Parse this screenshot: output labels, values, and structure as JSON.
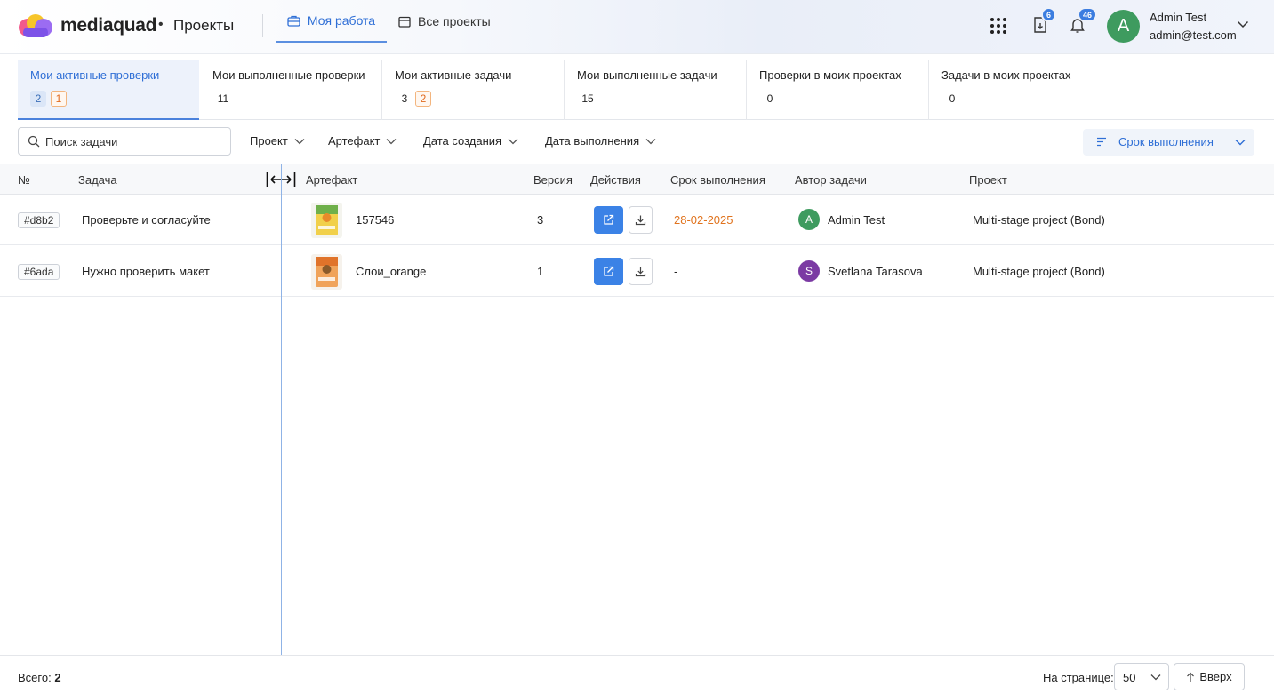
{
  "header": {
    "brand": "mediaquad",
    "separator_dot": "•",
    "app_title": "Проекты",
    "nav": [
      {
        "label": "Моя работа",
        "active": true,
        "icon": "briefcase-icon"
      },
      {
        "label": "Все проекты",
        "active": false,
        "icon": "calendar-icon"
      }
    ],
    "downloads_badge": "6",
    "notifications_badge": "46",
    "user": {
      "initial": "A",
      "name": "Admin Test",
      "email": "admin@test.com",
      "avatar_color": "#3e9b5f"
    }
  },
  "summary_tabs": [
    {
      "label": "Мои активные проверки",
      "counts": [
        "2",
        "1"
      ],
      "active": true
    },
    {
      "label": "Мои выполненные проверки",
      "counts": [
        "11"
      ]
    },
    {
      "label": "Мои активные задачи",
      "counts": [
        "3",
        "2"
      ]
    },
    {
      "label": "Мои выполненные задачи",
      "counts": [
        "15"
      ]
    },
    {
      "label": "Проверки в моих проектах",
      "counts": [
        "0"
      ]
    },
    {
      "label": "Задачи в моих проектах",
      "counts": [
        "0"
      ]
    }
  ],
  "filters": {
    "search_placeholder": "Поиск задачи",
    "project": "Проект",
    "artifact": "Артефакт",
    "created": "Дата создания",
    "due": "Дата выполнения",
    "sort_label": "Срок выполнения"
  },
  "table": {
    "columns": [
      "№",
      "Задача",
      "Артефакт",
      "Версия",
      "Действия",
      "Срок выполнения",
      "Автор задачи",
      "Проект"
    ],
    "rows": [
      {
        "id": "#d8b2",
        "task": "Проверьте и согласуйте",
        "artifact": "157546",
        "version": "3",
        "due": "28-02-2025",
        "due_color": "#e0731e",
        "author_initial": "A",
        "author": "Admin Test",
        "author_color": "#3e9b5f",
        "project": "Multi-stage project (Bond)"
      },
      {
        "id": "#6ada",
        "task": "Нужно проверить макет",
        "artifact": "Слои_orange",
        "version": "1",
        "due": "-",
        "due_color": "#222222",
        "author_initial": "S",
        "author": "Svetlana Tarasova",
        "author_color": "#7b3aa3",
        "project": "Multi-stage project (Bond)"
      }
    ]
  },
  "footer": {
    "total_label": "Всего:",
    "total_value": "2",
    "per_page_label": "На странице:",
    "per_page_value": "50",
    "up_label": "Вверх"
  },
  "colors": {
    "accent": "#2f6fd6",
    "action_blue": "#3b82e6",
    "warning_orange": "#e0731e"
  }
}
